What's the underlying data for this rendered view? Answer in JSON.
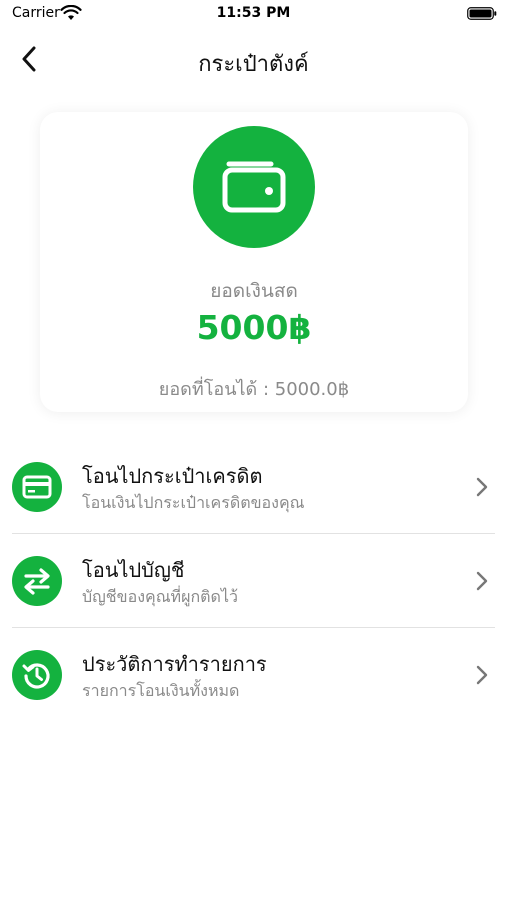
{
  "status_bar": {
    "carrier": "Carrier",
    "time": "11:53 PM"
  },
  "nav": {
    "title": "กระเป๋าตังค์",
    "back_icon": "chevron-left-icon"
  },
  "balance_card": {
    "icon": "wallet-icon",
    "label": "ยอดเงินสด",
    "amount": "5000฿",
    "transferable_label": "ยอดที่โอนได้ : ",
    "transferable_value": "5000.0฿"
  },
  "menu": {
    "items": [
      {
        "icon": "credit-card-icon",
        "title": "โอนไปกระเป๋าเครดิต",
        "subtitle": "โอนเงินไปกระเป๋าเครดิตของคุณ"
      },
      {
        "icon": "swap-arrows-icon",
        "title": "โอนไปบัญชี",
        "subtitle": "บัญชีของคุณที่ผูกติดไว้"
      },
      {
        "icon": "history-icon",
        "title": "ประวัติการทำรายการ",
        "subtitle": "รายการโอนเงินทั้งหมด"
      }
    ]
  },
  "colors": {
    "accent": "#14b23f",
    "secondary_text": "#8a8a8a",
    "divider": "#e2e2e2"
  }
}
